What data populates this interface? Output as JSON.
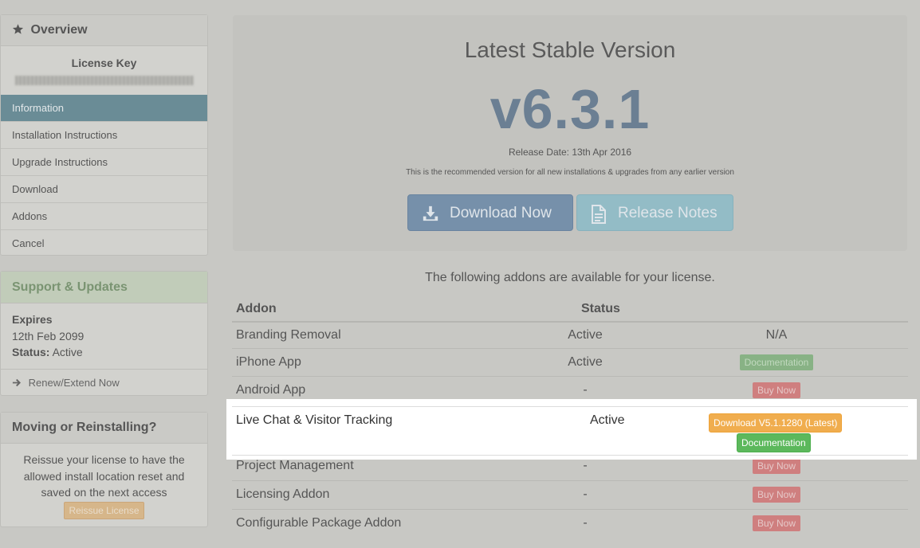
{
  "sidebar": {
    "overview": {
      "title": "Overview",
      "license_key_label": "License Key",
      "nav": [
        "Information",
        "Installation Instructions",
        "Upgrade Instructions",
        "Download",
        "Addons",
        "Cancel"
      ],
      "active_index": 0
    },
    "support": {
      "title": "Support & Updates",
      "expires_label": "Expires",
      "expires_value": "12th Feb 2099",
      "status_label": "Status:",
      "status_value": "Active",
      "renew_label": "Renew/Extend Now"
    },
    "moving": {
      "title": "Moving or Reinstalling?",
      "text": "Reissue your license to have the allowed install location reset and saved on the next access",
      "button": "Reissue License"
    }
  },
  "hero": {
    "title": "Latest Stable Version",
    "version": "v6.3.1",
    "release_date": "Release Date: 13th Apr 2016",
    "description": "This is the recommended version for all new installations & upgrades from any earlier version",
    "download_button": "Download Now",
    "release_notes_button": "Release Notes"
  },
  "addons": {
    "intro": "The following addons are available for your license.",
    "col_addon": "Addon",
    "col_status": "Status",
    "rows": [
      {
        "name": "Branding Removal",
        "status": "Active",
        "action": "N/A",
        "type": "text"
      },
      {
        "name": "iPhone App",
        "status": "Active",
        "action": "Documentation",
        "type": "doc"
      },
      {
        "name": "Android App",
        "status": "-",
        "action": "Buy Now",
        "type": "buy"
      },
      {
        "name": "Live Chat & Visitor Tracking",
        "status": "Active",
        "action": "Download V5.1.1280 (Latest)",
        "action2": "Documentation",
        "type": "highlight"
      },
      {
        "name": "Project Management",
        "status": "-",
        "action": "Buy Now",
        "type": "buy"
      },
      {
        "name": "Licensing Addon",
        "status": "-",
        "action": "Buy Now",
        "type": "buy"
      },
      {
        "name": "Configurable Package Addon",
        "status": "-",
        "action": "Buy Now",
        "type": "buy"
      }
    ]
  },
  "colors": {
    "active_nav": "#6a8c96",
    "version": "#6b7f93",
    "download_btn": "#7690aa",
    "release_notes_btn": "#93bcc6",
    "latest_download": "#f0ad4e",
    "documentation": "#5cb85c"
  }
}
